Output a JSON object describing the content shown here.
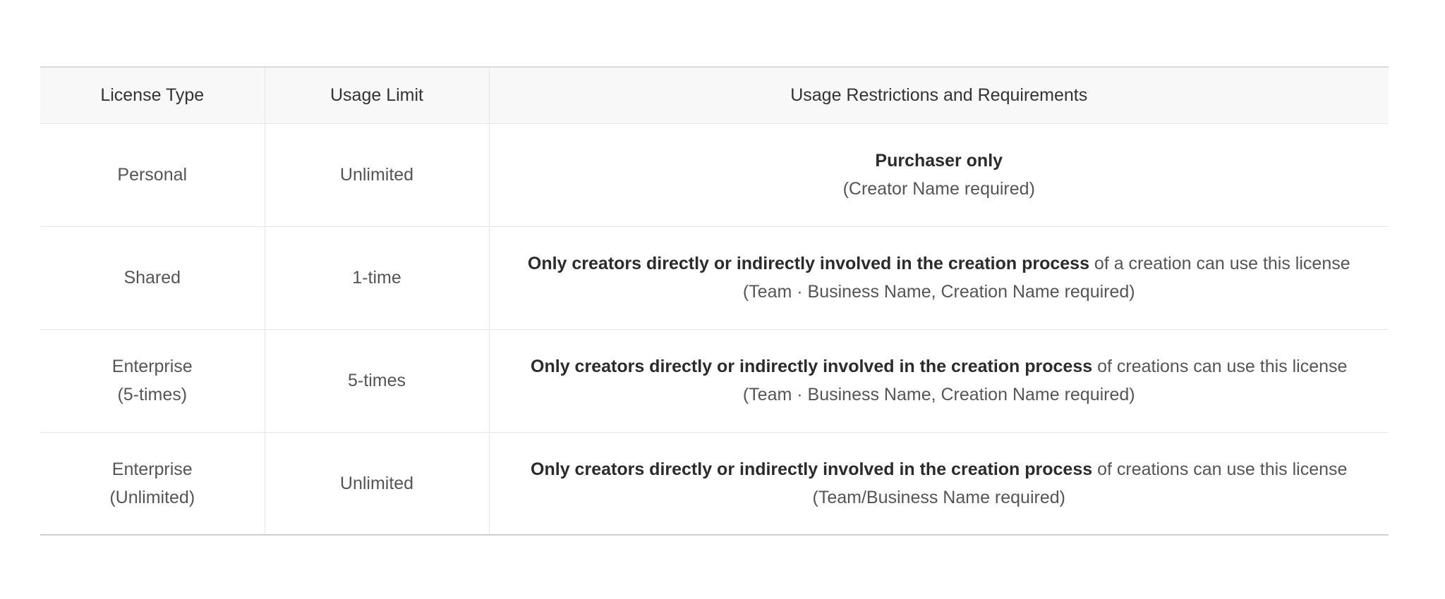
{
  "table": {
    "headers": [
      "License Type",
      "Usage Limit",
      "Usage Restrictions and Requirements"
    ],
    "rows": [
      {
        "type_line1": "Personal",
        "type_line2": "",
        "limit": "Unlimited",
        "restriction_bold": "Purchaser only",
        "restriction_rest": "",
        "requirement": "(Creator Name required)"
      },
      {
        "type_line1": "Shared",
        "type_line2": "",
        "limit": "1-time",
        "restriction_bold": "Only creators directly or indirectly involved in the creation process",
        "restriction_rest": " of a creation can use this license",
        "requirement": "(Team · Business Name, Creation Name required)"
      },
      {
        "type_line1": "Enterprise",
        "type_line2": "(5-times)",
        "limit": "5-times",
        "restriction_bold": "Only creators directly or indirectly involved in the creation process",
        "restriction_rest": " of creations can use this license",
        "requirement": "(Team · Business Name, Creation Name required)"
      },
      {
        "type_line1": "Enterprise",
        "type_line2": "(Unlimited)",
        "limit": "Unlimited",
        "restriction_bold": "Only creators directly or indirectly involved in the creation process",
        "restriction_rest": " of creations can use this license",
        "requirement": "(Team/Business Name required)"
      }
    ]
  }
}
